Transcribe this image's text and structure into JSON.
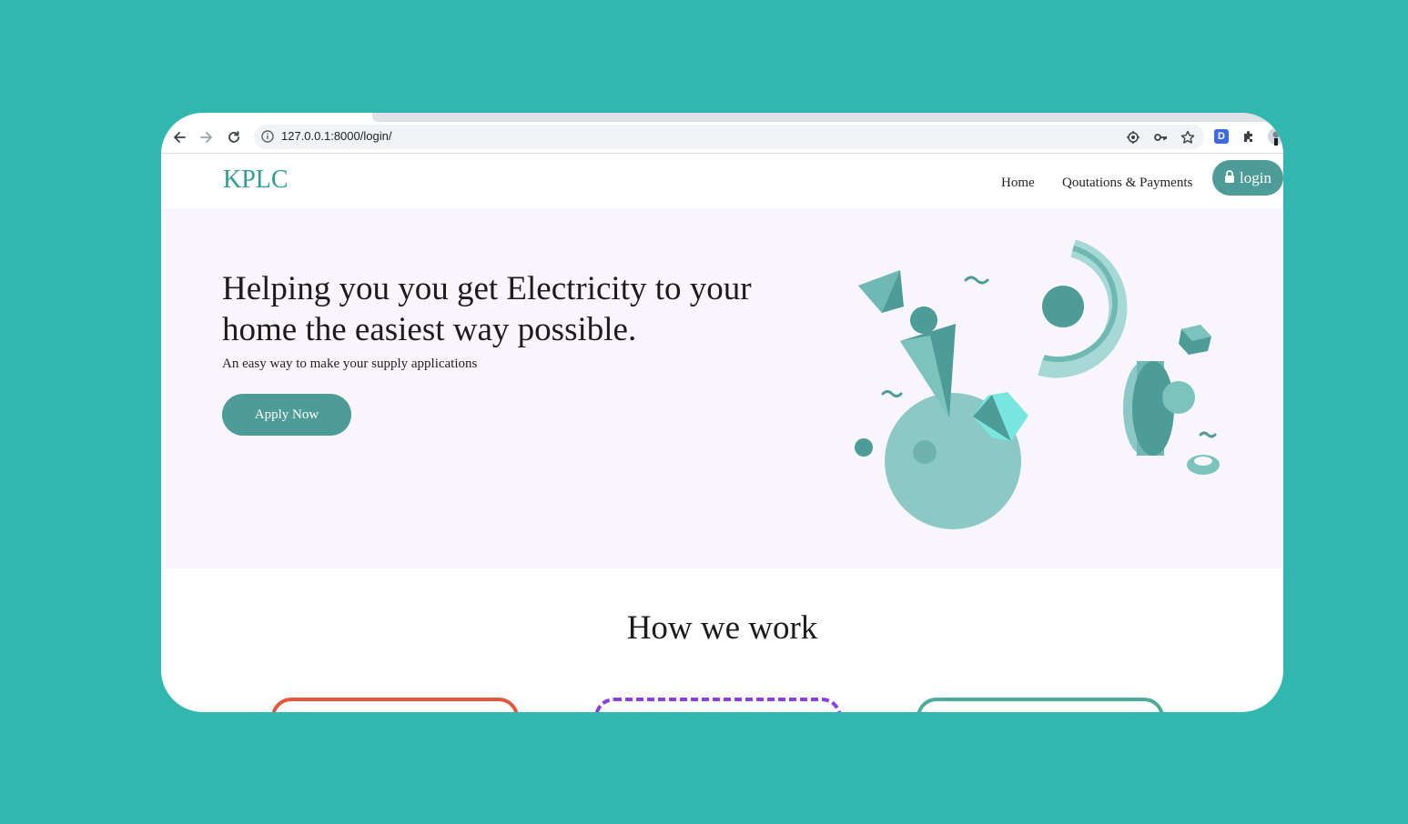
{
  "browser": {
    "url": "127.0.0.1:8000/login/",
    "ext_badge": "D"
  },
  "site": {
    "logo": "KPLC",
    "nav": {
      "home": "Home",
      "quotations": "Qoutations & Payments",
      "login": "login"
    }
  },
  "hero": {
    "title": "Helping you you get Electricity to your home the easiest way possible.",
    "subtitle": "An easy way to make your supply applications",
    "cta": "Apply Now"
  },
  "how": {
    "title": "How we work"
  },
  "colors": {
    "page_background": "#32b7b0",
    "brand": "#4e9c97",
    "logo": "#2f9e96",
    "hero_background": "#f8f6fc",
    "card_1_border": "#e4563a",
    "card_2_border": "#8a3fe0",
    "card_3_border": "#4cab9b"
  },
  "icons": [
    "back-arrow-icon",
    "forward-arrow-icon",
    "reload-icon",
    "info-icon",
    "location-icon",
    "key-icon",
    "star-icon",
    "extension-badge-icon",
    "puzzle-icon",
    "profile-avatar-icon",
    "lock-icon"
  ]
}
